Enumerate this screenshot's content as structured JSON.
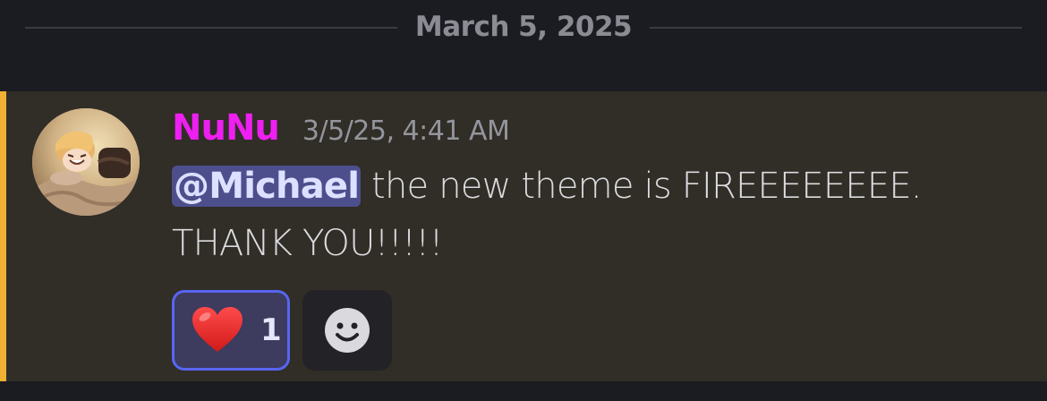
{
  "divider": {
    "date": "March 5, 2025"
  },
  "message": {
    "author": "NuNu",
    "author_color": "#ee1ff1",
    "timestamp": "3/5/25, 4:41 AM",
    "mention": "@Michael",
    "text_line1": " the new theme is FIREEEEEEEE.",
    "text_line2": "THANK YOU!!!!!",
    "highlight_color": "#f0b132",
    "reactions": [
      {
        "emoji": "heart-emoji",
        "count": "1",
        "selected": true
      }
    ],
    "add_reaction_icon": "smile-icon"
  }
}
